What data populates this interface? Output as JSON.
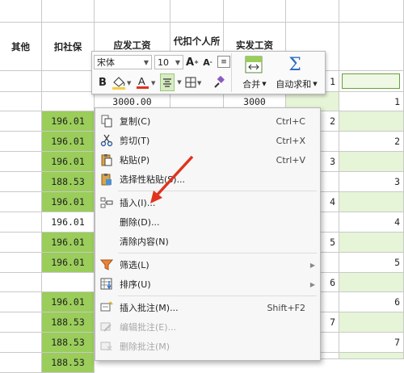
{
  "headers": {
    "other": "其他",
    "social": "扣社保",
    "payable": "应发工资",
    "withhold": "代扣个人所",
    "actual": "实发工资"
  },
  "rows": {
    "r1": {
      "payable": "3000.00",
      "actual": "3000"
    },
    "social_values": [
      "196.01",
      "196.01",
      "196.01",
      "188.53",
      "196.01",
      "196.01",
      "196.01",
      "196.01",
      "196.01",
      "188.53",
      "188.53",
      "188.53"
    ],
    "right_numbers_small": [
      "1",
      "2",
      "3",
      "4",
      "5",
      "6",
      "7"
    ],
    "right_numbers_big": [
      "1",
      "2",
      "3",
      "4",
      "5",
      "6",
      "7"
    ]
  },
  "toolbar": {
    "font_name": "宋体",
    "font_size": "10",
    "bold": "B",
    "merge_label": "合并",
    "autosum_label": "自动求和",
    "icons": [
      "font-grow-icon",
      "font-shrink-icon",
      "format-icon",
      "bold-icon",
      "fill-color-icon",
      "font-color-icon",
      "align-center-icon",
      "border-icon",
      "format-painter-icon",
      "merge-icon",
      "sum-icon"
    ]
  },
  "menu": {
    "items": [
      {
        "label": "复制(C)",
        "shortcut": "Ctrl+C",
        "icon": "copy-icon"
      },
      {
        "label": "剪切(T)",
        "shortcut": "Ctrl+X",
        "icon": "scissors-icon"
      },
      {
        "label": "粘贴(P)",
        "shortcut": "Ctrl+V",
        "icon": "paste-icon"
      },
      {
        "label": "选择性粘贴(S)...",
        "shortcut": "",
        "icon": "paste-special-icon"
      },
      {
        "label": "插入(I)...",
        "shortcut": "",
        "icon": "insert-icon"
      },
      {
        "label": "删除(D)...",
        "shortcut": "",
        "icon": ""
      },
      {
        "label": "清除内容(N)",
        "shortcut": "",
        "icon": ""
      },
      {
        "label": "筛选(L)",
        "shortcut": "",
        "icon": "filter-icon"
      },
      {
        "label": "排序(U)",
        "shortcut": "",
        "icon": "sort-icon"
      },
      {
        "label": "插入批注(M)...",
        "shortcut": "Shift+F2",
        "icon": "comment-icon"
      },
      {
        "label": "编辑批注(E)...",
        "shortcut": "",
        "icon": "edit-comment-icon"
      },
      {
        "label": "删除批注(M)",
        "shortcut": "",
        "icon": "delete-comment-icon"
      }
    ]
  },
  "colors": {
    "accent_green": "#9acd5a",
    "arrow": "#e0331e",
    "sum_blue": "#2e6fc2"
  }
}
